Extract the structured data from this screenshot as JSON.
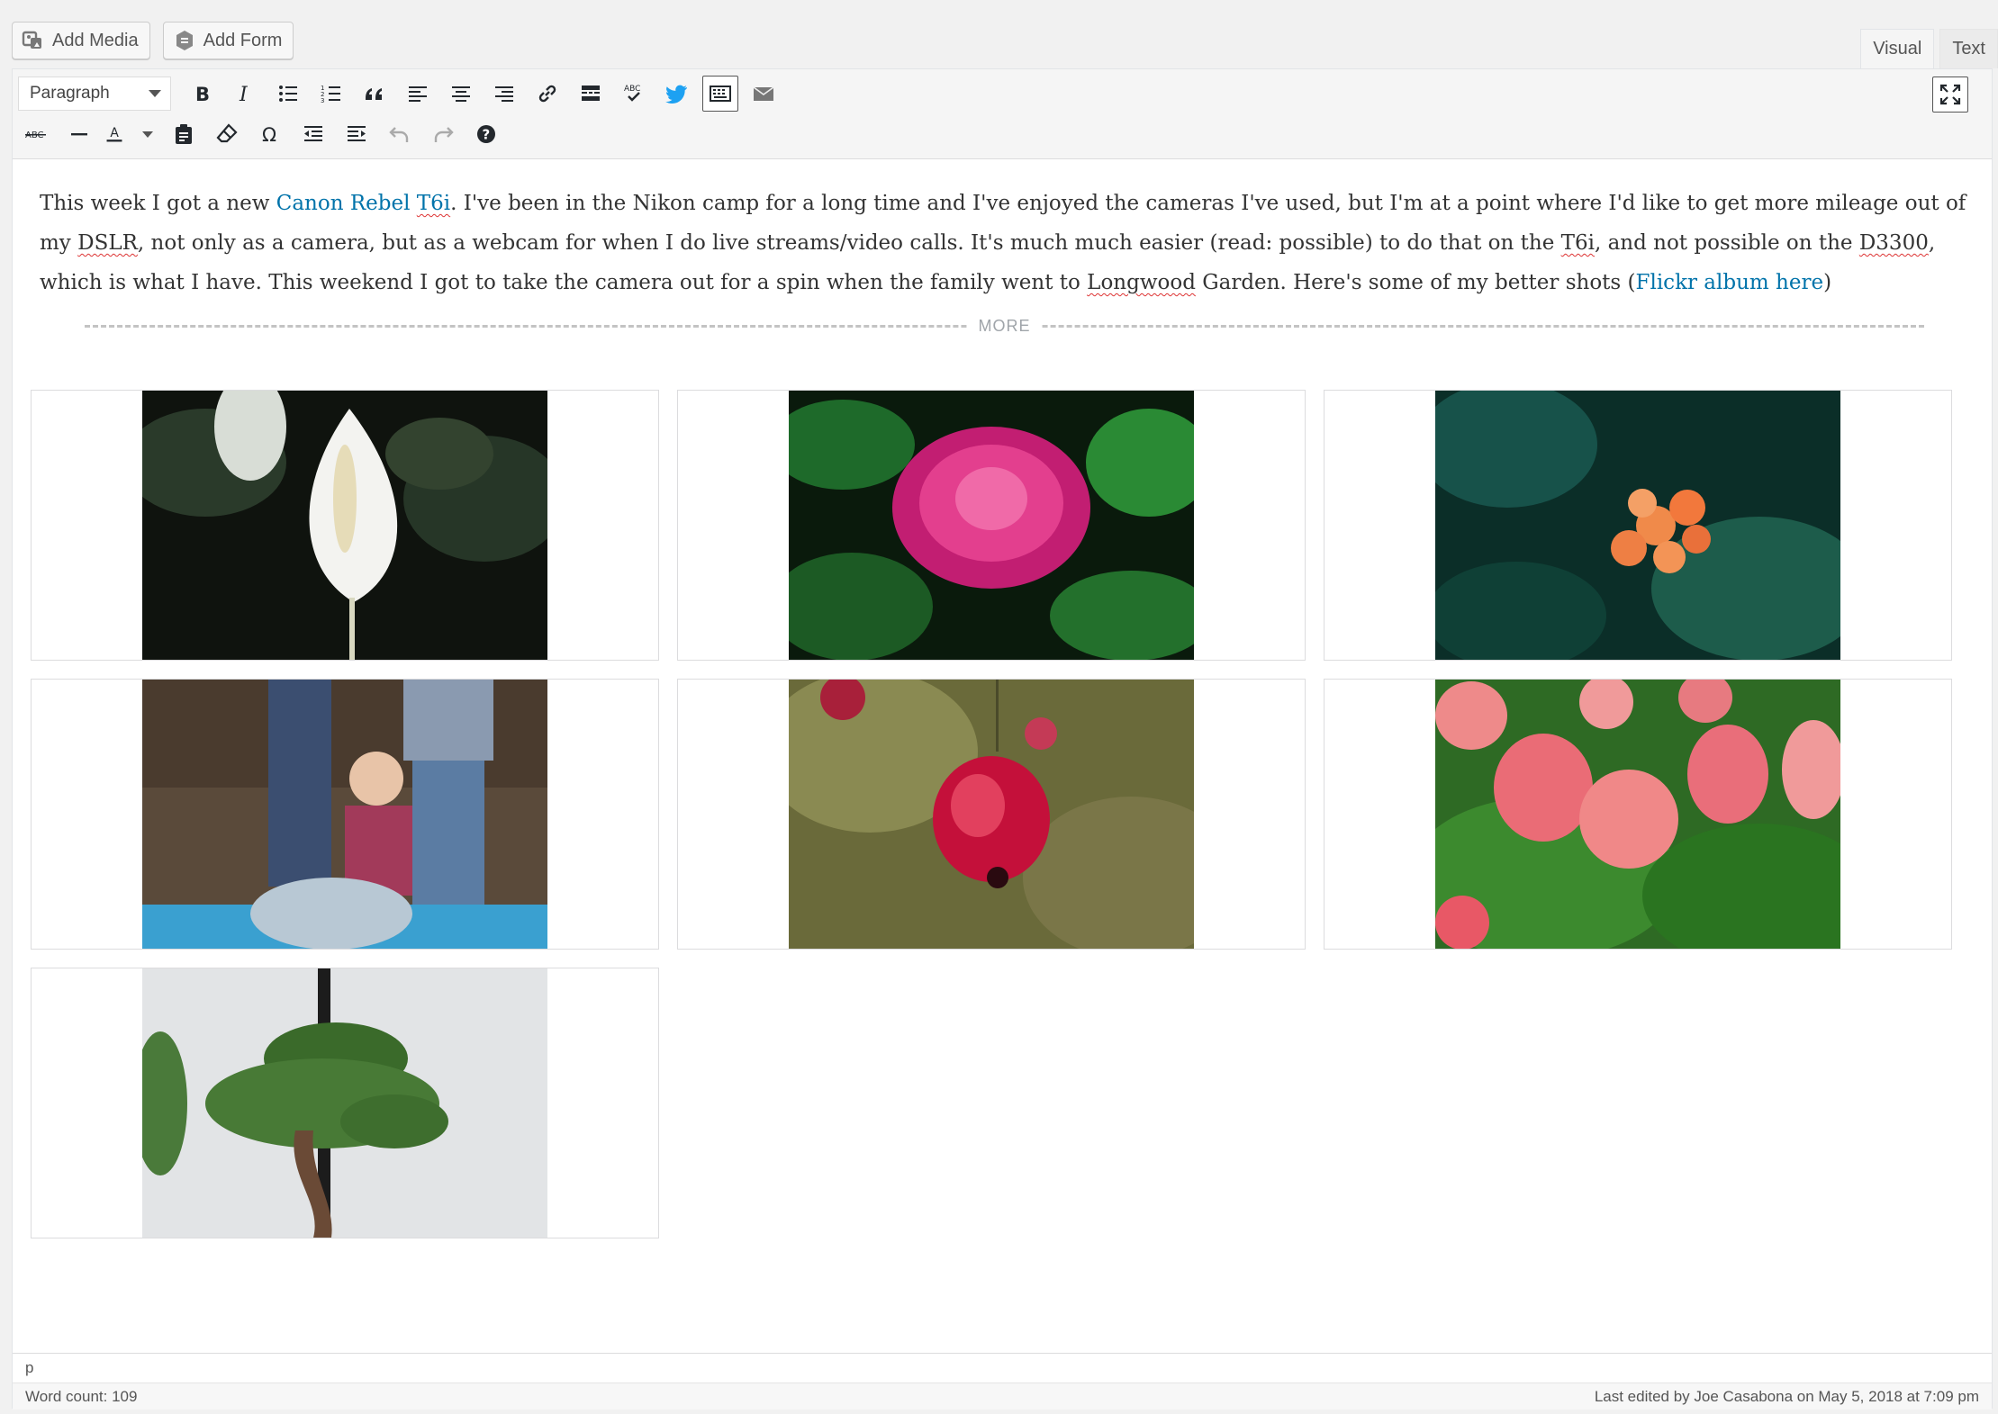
{
  "media_buttons": {
    "add_media": "Add Media",
    "add_form": "Add Form"
  },
  "tabs": {
    "visual": "Visual",
    "text": "Text",
    "active": "Visual"
  },
  "toolbar": {
    "format_select": "Paragraph",
    "row1": [
      "bold-icon",
      "italic-icon",
      "bullet-list-icon",
      "numbered-list-icon",
      "blockquote-icon",
      "align-left-icon",
      "align-center-icon",
      "align-right-icon",
      "link-icon",
      "read-more-icon",
      "spellcheck-icon",
      "twitter-icon",
      "toolbar-toggle-icon",
      "email-icon"
    ],
    "row2": [
      "strikethrough-icon",
      "horizontal-line-icon",
      "text-color-icon",
      "paste-text-icon",
      "clear-formatting-icon",
      "special-character-icon",
      "outdent-icon",
      "indent-icon",
      "undo-icon",
      "redo-icon",
      "help-icon"
    ],
    "spellcheck_label": "ABC",
    "text_color_label": "A"
  },
  "content": {
    "p1_a": "This week I got a new ",
    "link1": "Canon Rebel ",
    "link1_b": "T6i",
    "p1_b": ". I've been in the Nikon camp for a long time and I've enjoyed the cameras I've used, but I'm at a point where I'd like to get more mileage out of my ",
    "w_dslr": "DSLR",
    "p1_c": ", not only as a camera, but as a webcam for when I do live streams/video calls. It's much much easier (read: possible) to do that on the ",
    "w_t6i": "T6i",
    "p1_d": ", and not possible on the ",
    "w_d3300": "D3300",
    "p1_e": ", which is what I have. This weekend I got to take the camera out for a spin when the family went to ",
    "w_longwood": "Longwood",
    "p1_f": " Garden. Here's some of my better shots (",
    "link2": "Flickr album here",
    "p1_g": ")",
    "more_label": "MORE"
  },
  "gallery": [
    {
      "name": "peace-lily-photo"
    },
    {
      "name": "pink-puff-flower-photo"
    },
    {
      "name": "orange-clivia-photo"
    },
    {
      "name": "toddler-fountain-photo"
    },
    {
      "name": "red-lantern-flower-photo"
    },
    {
      "name": "pink-tulips-photo"
    },
    {
      "name": "bonsai-tree-photo"
    }
  ],
  "status": {
    "path": "p",
    "word_count": "Word count: 109",
    "last_edited": "Last edited by Joe Casabona on May 5, 2018 at 7:09 pm"
  },
  "colors": {
    "link": "#0073aa",
    "twitter": "#1da1f2"
  }
}
